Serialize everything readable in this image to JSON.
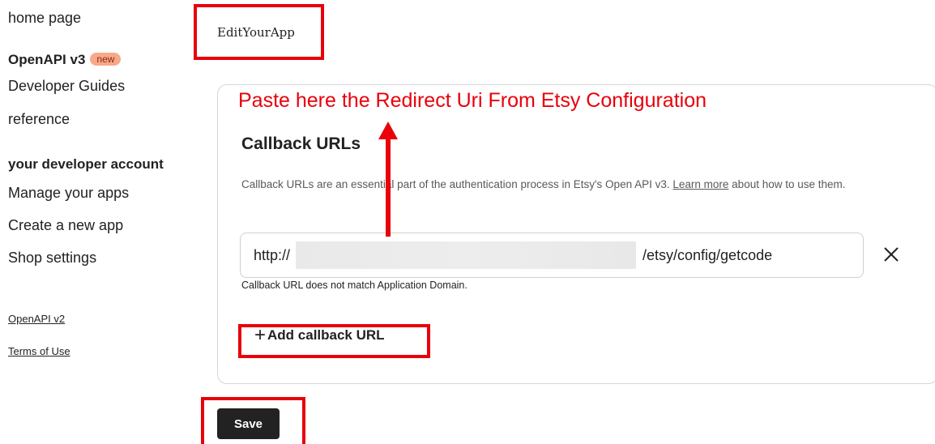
{
  "sidebar": {
    "home": "home page",
    "openapi_v3": "OpenAPI v3",
    "new_badge": "new",
    "developer_guides": "Developer Guides",
    "reference": "reference",
    "account_heading": "your developer account",
    "manage_apps": "Manage your apps",
    "create_app": "Create a new app",
    "shop_settings": "Shop settings",
    "openapi_v2": "OpenAPI v2",
    "terms": "Terms of Use"
  },
  "app": {
    "name": "EditYourApp"
  },
  "annotation": {
    "text": "Paste here the Redirect Uri From Etsy Configuration",
    "color": "#e8000b"
  },
  "callback": {
    "title": "Callback URLs",
    "desc_before": "Callback URLs are an essential part of the authentication process in Etsy's Open API v3. ",
    "learn_more": "Learn more",
    "desc_after": " about how to use them.",
    "url_prefix": "http://",
    "url_suffix": "/etsy/config/getcode",
    "error": "Callback URL does not match Application Domain.",
    "add_label": "Add callback URL"
  },
  "actions": {
    "save": "Save"
  },
  "icons": {
    "clear": "close-icon",
    "add": "plus-icon",
    "arrow": "arrow-up-icon"
  }
}
